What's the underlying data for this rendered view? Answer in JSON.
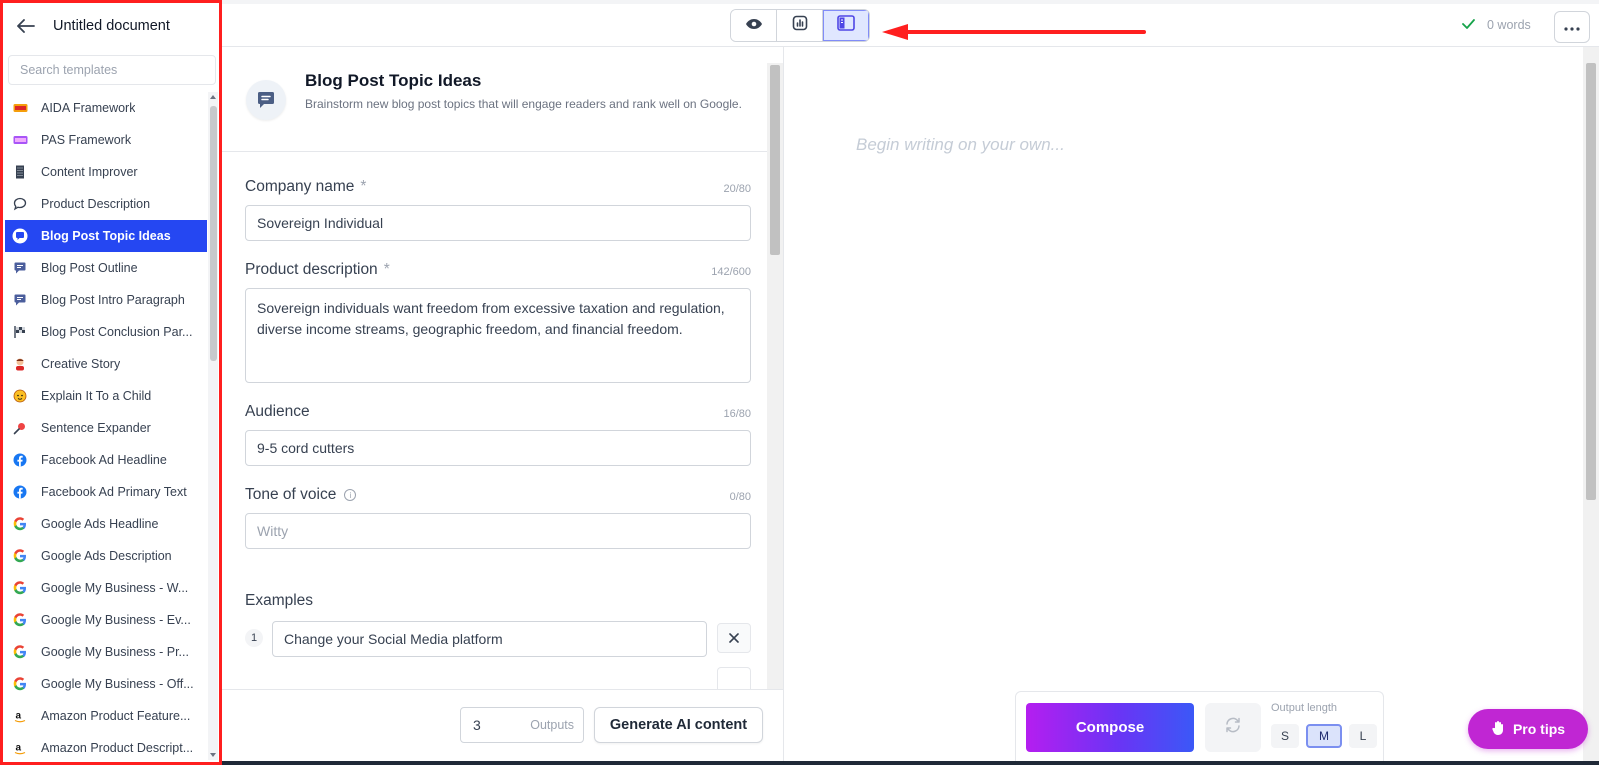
{
  "document": {
    "title": "Untitled document"
  },
  "sidebar": {
    "search_placeholder": "Search templates",
    "items": [
      {
        "label": "AIDA Framework",
        "icon": "aida-icon"
      },
      {
        "label": "PAS Framework",
        "icon": "pas-icon"
      },
      {
        "label": "Content Improver",
        "icon": "content-improver-icon"
      },
      {
        "label": "Product Description",
        "icon": "speech-bubble-icon"
      },
      {
        "label": "Blog Post Topic Ideas",
        "icon": "blog-chat-icon",
        "active": true
      },
      {
        "label": "Blog Post Outline",
        "icon": "blog-chat-icon"
      },
      {
        "label": "Blog Post Intro Paragraph",
        "icon": "blog-chat-icon"
      },
      {
        "label": "Blog Post Conclusion Par...",
        "icon": "flag-icon"
      },
      {
        "label": "Creative Story",
        "icon": "person-icon"
      },
      {
        "label": "Explain It To a Child",
        "icon": "baby-face-icon"
      },
      {
        "label": "Sentence Expander",
        "icon": "magnifier-icon"
      },
      {
        "label": "Facebook Ad Headline",
        "icon": "facebook-icon"
      },
      {
        "label": "Facebook Ad Primary Text",
        "icon": "facebook-icon"
      },
      {
        "label": "Google Ads Headline",
        "icon": "google-icon"
      },
      {
        "label": "Google Ads Description",
        "icon": "google-icon"
      },
      {
        "label": "Google My Business - W...",
        "icon": "google-icon"
      },
      {
        "label": "Google My Business - Ev...",
        "icon": "google-icon"
      },
      {
        "label": "Google My Business - Pr...",
        "icon": "google-icon"
      },
      {
        "label": "Google My Business - Off...",
        "icon": "google-icon"
      },
      {
        "label": "Amazon Product Feature...",
        "icon": "amazon-icon"
      },
      {
        "label": "Amazon Product Descript...",
        "icon": "amazon-icon"
      }
    ]
  },
  "topbar": {
    "word_count": "0 words",
    "view_modes": [
      "preview-eye-icon",
      "chart-icon",
      "sidebar-layout-icon"
    ],
    "active_view": "sidebar-layout-icon"
  },
  "template": {
    "title": "Blog Post Topic Ideas",
    "description": "Brainstorm new blog post topics that will engage readers and rank well on Google.",
    "fields": {
      "company": {
        "label": "Company name",
        "required": "*",
        "count": "20/80",
        "value": "Sovereign Individual"
      },
      "product": {
        "label": "Product description",
        "required": "*",
        "count": "142/600",
        "value": "Sovereign individuals want freedom from excessive taxation and regulation, diverse income streams, geographic freedom, and financial freedom."
      },
      "audience": {
        "label": "Audience",
        "count": "16/80",
        "value": "9-5 cord cutters"
      },
      "tone": {
        "label": "Tone of voice",
        "count": "0/80",
        "placeholder": "Witty"
      }
    },
    "examples": {
      "label": "Examples",
      "items": [
        {
          "num": "1",
          "value": "Change your Social Media platform"
        }
      ]
    }
  },
  "footer": {
    "outputs_value": "3",
    "outputs_label": "Outputs",
    "generate_label": "Generate AI content"
  },
  "editor": {
    "placeholder": "Begin writing on your own...",
    "compose_label": "Compose",
    "output_length_label": "Output length",
    "sizes": [
      "S",
      "M",
      "L"
    ],
    "active_size": "M",
    "pro_tips_label": "Pro tips"
  },
  "colors": {
    "accent": "#2547f2",
    "highlight_red": "#ff1f1f",
    "pro_tips": "#c026d3"
  }
}
